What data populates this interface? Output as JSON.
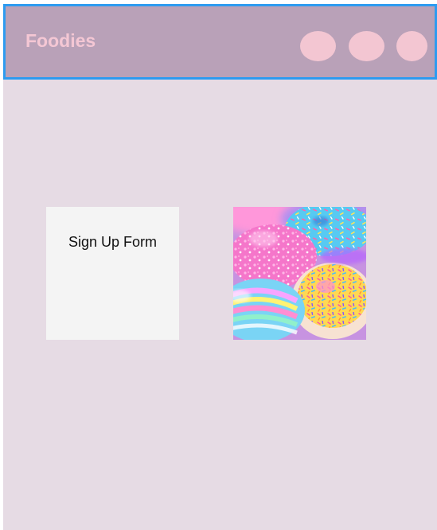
{
  "header": {
    "brand": "Foodies",
    "nav_icons": [
      "nav-dot-icon",
      "nav-dot-icon",
      "nav-dot-icon"
    ]
  },
  "main": {
    "signup_card": {
      "label": "Sign Up Form"
    },
    "image": {
      "alt": "Colorful sprinkled donuts"
    }
  },
  "colors": {
    "header_bg": "#b9a1b8",
    "header_border": "#2d9bf0",
    "brand_text": "#f4c7d4",
    "page_bg": "#e6dbe4",
    "card_bg": "#f4f4f4"
  }
}
